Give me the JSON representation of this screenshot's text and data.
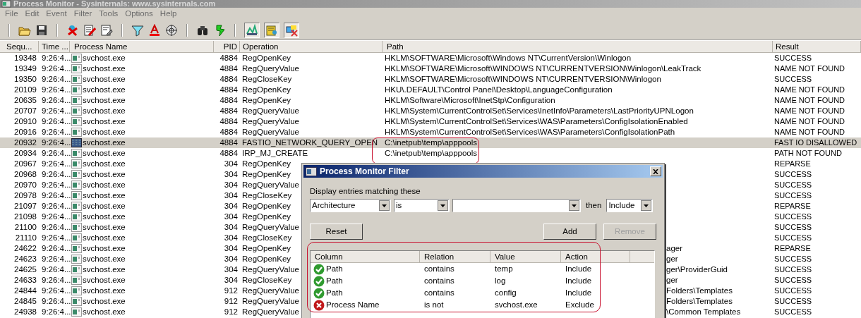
{
  "window": {
    "title": "Process Monitor - Sysinternals: www.sysinternals.com"
  },
  "menu": [
    "File",
    "Edit",
    "Event",
    "Filter",
    "Tools",
    "Options",
    "Help"
  ],
  "toolbar_toggles": [
    {
      "pressed": true
    },
    {
      "pressed": true
    },
    {
      "pressed": true
    }
  ],
  "table": {
    "columns": [
      "Sequ...",
      "Time ...",
      "Process Name",
      "PID",
      "Operation",
      "Path",
      "Result"
    ],
    "rows": [
      {
        "seq": "19348",
        "time": "9:26:4...",
        "process": "svchost.exe",
        "pid": "4884",
        "operation": "RegOpenKey",
        "path": "HKLM\\SOFTWARE\\Microsoft\\Windows NT\\CurrentVersion\\Winlogon",
        "result": "SUCCESS",
        "selected": false
      },
      {
        "seq": "19349",
        "time": "9:26:4...",
        "process": "svchost.exe",
        "pid": "4884",
        "operation": "RegQueryValue",
        "path": "HKLM\\SOFTWARE\\Microsoft\\WINDOWS NT\\CURRENTVERSION\\Winlogon\\LeakTrack",
        "result": "NAME NOT FOUND",
        "selected": false
      },
      {
        "seq": "19350",
        "time": "9:26:4...",
        "process": "svchost.exe",
        "pid": "4884",
        "operation": "RegCloseKey",
        "path": "HKLM\\SOFTWARE\\Microsoft\\WINDOWS NT\\CURRENTVERSION\\Winlogon",
        "result": "SUCCESS",
        "selected": false
      },
      {
        "seq": "20109",
        "time": "9:26:4...",
        "process": "svchost.exe",
        "pid": "4884",
        "operation": "RegOpenKey",
        "path": "HKU\\.DEFAULT\\Control Panel\\Desktop\\LanguageConfiguration",
        "result": "NAME NOT FOUND",
        "selected": false
      },
      {
        "seq": "20635",
        "time": "9:26:4...",
        "process": "svchost.exe",
        "pid": "4884",
        "operation": "RegOpenKey",
        "path": "HKLM\\Software\\Microsoft\\InetStp\\Configuration",
        "result": "NAME NOT FOUND",
        "selected": false
      },
      {
        "seq": "20707",
        "time": "9:26:4...",
        "process": "svchost.exe",
        "pid": "4884",
        "operation": "RegQueryValue",
        "path": "HKLM\\System\\CurrentControlSet\\Services\\InetInfo\\Parameters\\LastPriorityUPNLogon",
        "result": "NAME NOT FOUND",
        "selected": false
      },
      {
        "seq": "20910",
        "time": "9:26:4...",
        "process": "svchost.exe",
        "pid": "4884",
        "operation": "RegQueryValue",
        "path": "HKLM\\System\\CurrentControlSet\\Services\\WAS\\Parameters\\ConfigIsolationEnabled",
        "result": "NAME NOT FOUND",
        "selected": false
      },
      {
        "seq": "20916",
        "time": "9:26:4...",
        "process": "svchost.exe",
        "pid": "4884",
        "operation": "RegQueryValue",
        "path": "HKLM\\System\\CurrentControlSet\\Services\\WAS\\Parameters\\ConfigIsolationPath",
        "result": "NAME NOT FOUND",
        "selected": false
      },
      {
        "seq": "20932",
        "time": "9:26:4...",
        "process": "svchost.exe",
        "pid": "4884",
        "operation": "FASTIO_NETWORK_QUERY_OPEN",
        "path": "C:\\inetpub\\temp\\apppools",
        "result": "FAST IO DISALLOWED",
        "selected": true
      },
      {
        "seq": "20934",
        "time": "9:26:4...",
        "process": "svchost.exe",
        "pid": "4884",
        "operation": "IRP_MJ_CREATE",
        "path": "C:\\inetpub\\temp\\apppools",
        "result": "PATH NOT FOUND",
        "selected": false
      },
      {
        "seq": "20967",
        "time": "9:26:4...",
        "process": "svchost.exe",
        "pid": "304",
        "operation": "RegOpenKey",
        "result": "REPARSE",
        "selected": false
      },
      {
        "seq": "20968",
        "time": "9:26:4...",
        "process": "svchost.exe",
        "pid": "304",
        "operation": "RegOpenKey",
        "result": "SUCCESS",
        "selected": false
      },
      {
        "seq": "20970",
        "time": "9:26:4...",
        "process": "svchost.exe",
        "pid": "304",
        "operation": "RegQueryValue",
        "result": "SUCCESS",
        "selected": false
      },
      {
        "seq": "20978",
        "time": "9:26:4...",
        "process": "svchost.exe",
        "pid": "304",
        "operation": "RegCloseKey",
        "result": "SUCCESS",
        "selected": false
      },
      {
        "seq": "21097",
        "time": "9:26:4...",
        "process": "svchost.exe",
        "pid": "304",
        "operation": "RegOpenKey",
        "result": "REPARSE",
        "selected": false
      },
      {
        "seq": "21098",
        "time": "9:26:4...",
        "process": "svchost.exe",
        "pid": "304",
        "operation": "RegOpenKey",
        "result": "SUCCESS",
        "selected": false
      },
      {
        "seq": "21100",
        "time": "9:26:4...",
        "process": "svchost.exe",
        "pid": "304",
        "operation": "RegQueryValue",
        "result": "SUCCESS",
        "selected": false
      },
      {
        "seq": "21110",
        "time": "9:26:4...",
        "process": "svchost.exe",
        "pid": "304",
        "operation": "RegCloseKey",
        "result": "SUCCESS",
        "selected": false
      },
      {
        "seq": "24622",
        "time": "9:26:4...",
        "process": "svchost.exe",
        "pid": "304",
        "operation": "RegOpenKey",
        "path": "ager",
        "path_partial": true,
        "result": "REPARSE",
        "selected": false
      },
      {
        "seq": "24623",
        "time": "9:26:4...",
        "process": "svchost.exe",
        "pid": "304",
        "operation": "RegOpenKey",
        "path": "ger",
        "path_partial": true,
        "result": "SUCCESS",
        "selected": false
      },
      {
        "seq": "24625",
        "time": "9:26:4...",
        "process": "svchost.exe",
        "pid": "304",
        "operation": "RegQueryValue",
        "path": "ger\\ProviderGuid",
        "path_partial": true,
        "result": "SUCCESS",
        "selected": false
      },
      {
        "seq": "24633",
        "time": "9:26:4...",
        "process": "svchost.exe",
        "pid": "304",
        "operation": "RegCloseKey",
        "path": "ger",
        "path_partial": true,
        "result": "SUCCESS",
        "selected": false
      },
      {
        "seq": "24844",
        "time": "9:26:4...",
        "process": "svchost.exe",
        "pid": "912",
        "operation": "RegQueryValue",
        "path": "Folders\\Templates",
        "path_partial": true,
        "result": "SUCCESS",
        "selected": false
      },
      {
        "seq": "24845",
        "time": "9:26:4...",
        "process": "svchost.exe",
        "pid": "912",
        "operation": "RegQueryValue",
        "path": "Folders\\Templates",
        "path_partial": true,
        "result": "SUCCESS",
        "selected": false
      },
      {
        "seq": "24938",
        "time": "9:26:4...",
        "process": "svchost.exe",
        "pid": "912",
        "operation": "RegQueryValue",
        "path": "\\Common Templates",
        "path_partial": true,
        "result": "SUCCESS",
        "selected": false
      }
    ]
  },
  "filter_dialog": {
    "title": "Process Monitor Filter",
    "prompt": "Display entries matching these",
    "column": "Architecture",
    "relation": "is",
    "then_label": "then",
    "action": "Include",
    "buttons": [
      {
        "label": "Reset",
        "disabled": false
      },
      {
        "label": "Add",
        "disabled": false
      },
      {
        "label": "Remove",
        "disabled": true
      }
    ],
    "list_columns": [
      "Column",
      "Relation",
      "Value",
      "Action"
    ],
    "rules": [
      {
        "kind": "include",
        "column": "Path",
        "relation": "contains",
        "value": "temp",
        "action": "Include"
      },
      {
        "kind": "include",
        "column": "Path",
        "relation": "contains",
        "value": "log",
        "action": "Include"
      },
      {
        "kind": "include",
        "column": "Path",
        "relation": "contains",
        "value": "config",
        "action": "Include"
      },
      {
        "kind": "exclude",
        "column": "Process Name",
        "relation": "is not",
        "value": "svchost.exe",
        "action": "Exclude"
      }
    ]
  }
}
